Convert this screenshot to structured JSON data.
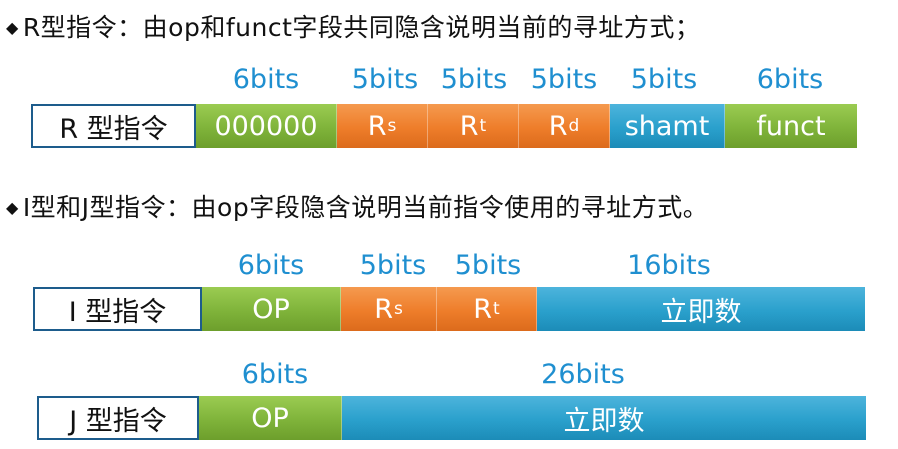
{
  "headings": {
    "r_type": "R型指令：由op和funct字段共同隐含说明当前的寻址方式；",
    "ij_type": "I型和J型指令：由op字段隐含说明当前指令使用的寻址方式。",
    "bullet": "◆"
  },
  "r_format": {
    "label": "R 型指令",
    "bits": [
      "6bits",
      "5bits",
      "5bits",
      "5bits",
      "5bits",
      "6bits"
    ],
    "fields": [
      {
        "main": "000000",
        "sub": ""
      },
      {
        "main": "R",
        "sub": "s"
      },
      {
        "main": "R",
        "sub": "t"
      },
      {
        "main": "R",
        "sub": "d"
      },
      {
        "main": "shamt",
        "sub": ""
      },
      {
        "main": "funct",
        "sub": ""
      }
    ]
  },
  "i_format": {
    "label": "I 型指令",
    "bits": [
      "6bits",
      "5bits",
      "5bits",
      "16bits"
    ],
    "fields": [
      {
        "main": "OP",
        "sub": ""
      },
      {
        "main": "R",
        "sub": "s"
      },
      {
        "main": "R",
        "sub": "t"
      },
      {
        "main": "立即数",
        "sub": ""
      }
    ]
  },
  "j_format": {
    "label": "J 型指令",
    "bits": [
      "6bits",
      "26bits"
    ],
    "fields": [
      {
        "main": "OP",
        "sub": ""
      },
      {
        "main": "立即数",
        "sub": ""
      }
    ]
  },
  "colors": {
    "bits_text": "#1f8fd0",
    "green": "#7fb33a",
    "orange": "#ee7d2a",
    "blue": "#2aa0cc",
    "label_border": "#1d5c8c"
  }
}
